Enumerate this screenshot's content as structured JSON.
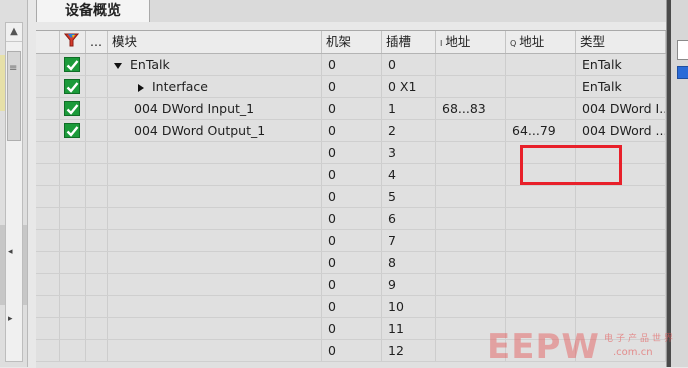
{
  "tab": {
    "title": "设备概览"
  },
  "table": {
    "headers": {
      "col_dots": "...",
      "module": "模块",
      "rack": "机架",
      "slot": "插槽",
      "i_address_prefix": "I",
      "i_address": "地址",
      "q_address_prefix": "Q",
      "q_address": "地址",
      "type": "类型"
    },
    "rows": [
      {
        "module": "EnTalk",
        "rack": "0",
        "slot": "0",
        "i_addr": "",
        "q_addr": "",
        "type": "EnTalk",
        "status": "ok"
      },
      {
        "module": "Interface",
        "rack": "0",
        "slot": "0 X1",
        "i_addr": "",
        "q_addr": "",
        "type": "EnTalk",
        "status": "ok"
      },
      {
        "module": "004 DWord Input_1",
        "rack": "0",
        "slot": "1",
        "i_addr": "68...83",
        "q_addr": "",
        "type": "004 DWord I...",
        "status": "ok"
      },
      {
        "module": "004 DWord Output_1",
        "rack": "0",
        "slot": "2",
        "i_addr": "",
        "q_addr": "64...79",
        "type": "004 DWord ...",
        "status": "ok"
      },
      {
        "module": "",
        "rack": "0",
        "slot": "3",
        "i_addr": "",
        "q_addr": "",
        "type": ""
      },
      {
        "module": "",
        "rack": "0",
        "slot": "4",
        "i_addr": "",
        "q_addr": "",
        "type": ""
      },
      {
        "module": "",
        "rack": "0",
        "slot": "5",
        "i_addr": "",
        "q_addr": "",
        "type": ""
      },
      {
        "module": "",
        "rack": "0",
        "slot": "6",
        "i_addr": "",
        "q_addr": "",
        "type": ""
      },
      {
        "module": "",
        "rack": "0",
        "slot": "7",
        "i_addr": "",
        "q_addr": "",
        "type": ""
      },
      {
        "module": "",
        "rack": "0",
        "slot": "8",
        "i_addr": "",
        "q_addr": "",
        "type": ""
      },
      {
        "module": "",
        "rack": "0",
        "slot": "9",
        "i_addr": "",
        "q_addr": "",
        "type": ""
      },
      {
        "module": "",
        "rack": "0",
        "slot": "10",
        "i_addr": "",
        "q_addr": "",
        "type": ""
      },
      {
        "module": "",
        "rack": "0",
        "slot": "11",
        "i_addr": "",
        "q_addr": "",
        "type": ""
      },
      {
        "module": "",
        "rack": "0",
        "slot": "12",
        "i_addr": "",
        "q_addr": "",
        "type": ""
      }
    ]
  },
  "watermark": {
    "logo": "EEPW",
    "tagline": "电子产品世界",
    "url": ".com.cn"
  },
  "colors": {
    "status_ok": "#1b9a3a",
    "highlight_box": "#e8202a"
  },
  "icons": [
    "filter-icon",
    "check-icon",
    "expand-arrow-icon",
    "collapse-arrow-icon"
  ]
}
